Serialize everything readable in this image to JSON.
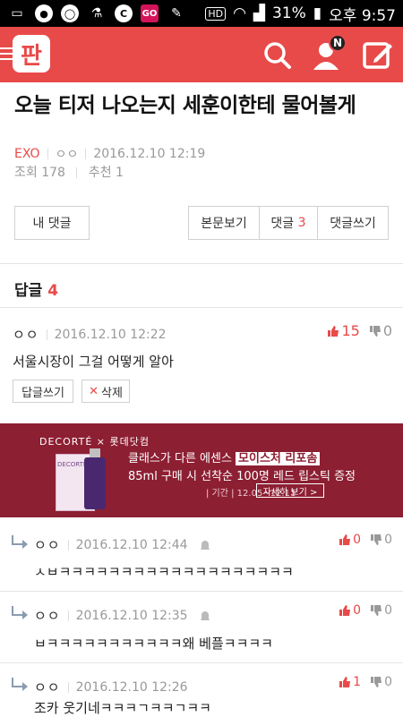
{
  "status_bar": {
    "battery_pct": "31%",
    "time": "오후 9:57",
    "hd_label": "HD",
    "go_label": "GO"
  },
  "header": {
    "logo_text": "판",
    "notification_badge": "N"
  },
  "post": {
    "title": "오늘 티저 나오는지 세훈이한테 물어볼게",
    "category": "EXO",
    "author": "ㅇㅇ",
    "date": "2016.12.10 12:19",
    "views_label": "조회 178",
    "recommend_label": "추천 1"
  },
  "actions": {
    "my_comments": "내 댓글",
    "view_body": "본문보기",
    "comments_label": "댓글",
    "comments_count": "3",
    "write_comment": "댓글쓰기"
  },
  "replies_section": {
    "label": "답글",
    "count": "4"
  },
  "main_comment": {
    "author": "ㅇㅇ",
    "date": "2016.12.10 12:22",
    "text": "서울시장이 그걸 어떻게 알아",
    "up": "15",
    "down": "0",
    "reply_button": "답글쓰기",
    "delete_button": "삭제"
  },
  "ad": {
    "brand": "DECORTÉ × 롯데닷컴",
    "product_label": "DECORTÉ",
    "line1_pre": "클래스가 다른 에센스",
    "line1_highlight": "모이스처 리포솜",
    "line2": "85ml 구매 시 선착순 100명 레드 립스틱 증정",
    "period": "| 기간 | 12.05~12.11",
    "cta": "자세히 보기 >"
  },
  "replies": [
    {
      "author": "ㅇㅇ",
      "date": "2016.12.10 12:44",
      "text": "ㅅㅂㅋㅋㅋㅋㅋㅋㅋㅋㅋㅋㅋㅋㅋㅋㅋㅋㅋㅋㅋ",
      "up": "0",
      "down": "0"
    },
    {
      "author": "ㅇㅇ",
      "date": "2016.12.10 12:35",
      "text": "ㅂㅋㅋㅋㅋㅋㅋㅋㅋㅋㅋㅋ왜 베플ㅋㅋㅋㅋ",
      "up": "0",
      "down": "0"
    },
    {
      "author": "ㅇㅇ",
      "date": "2016.12.10 12:26",
      "text": "조카 웃기네ㅋㅋㅋㄱㅋㅋㄱㅋㅋ",
      "up": "1",
      "down": "0"
    }
  ],
  "colors": {
    "brand": "#e84a4a",
    "ad_bg": "#8d1f33"
  },
  "icons": [
    "search-icon",
    "user-icon",
    "edit-icon",
    "thumb-up-icon",
    "thumb-down-icon",
    "reply-arrow-icon",
    "bell-icon"
  ]
}
